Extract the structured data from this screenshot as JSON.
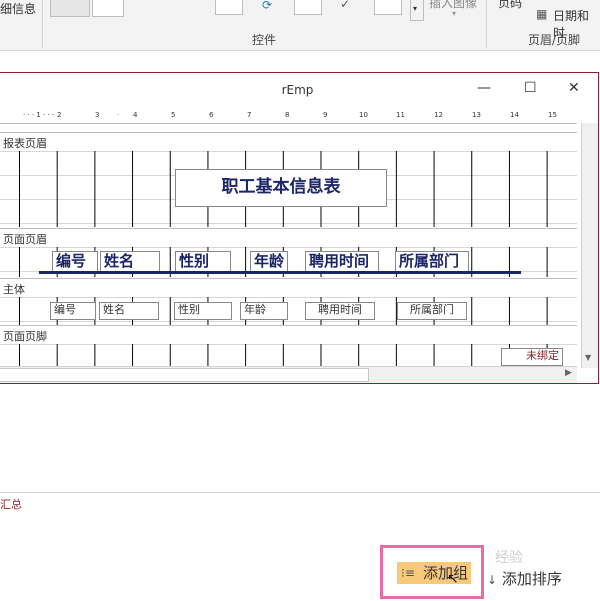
{
  "ribbon": {
    "left_cut_text": "细信息",
    "insert_image_label": "插入图像",
    "controls_group_label": "控件",
    "page_number_label": "页码",
    "date_time_label": "日期和时",
    "header_footer_group_label": "页眉/页脚"
  },
  "window": {
    "title": "rEmp",
    "minimize_glyph": "—",
    "maximize_glyph": "☐",
    "close_glyph": "✕",
    "ruler_numbers": [
      "1",
      "2",
      "3",
      "4",
      "5",
      "6",
      "7",
      "8",
      "9",
      "10",
      "11",
      "12",
      "13",
      "14",
      "15"
    ]
  },
  "sections": {
    "report_header": "报表页眉",
    "page_header": "页面页眉",
    "detail": "主体",
    "page_footer": "页面页脚"
  },
  "report_title": "职工基本信息表",
  "header_labels": [
    "编号",
    "姓名",
    "性别",
    "年龄",
    "聘用时间",
    "所属部门"
  ],
  "detail_fields": [
    "编号",
    "姓名",
    "性别",
    "年龄",
    "聘用时间",
    "所属部门"
  ],
  "unbound_text": "未绑定",
  "bottom": {
    "summary_label": "汇总",
    "add_group_label": "添加组",
    "add_sort_label": "添加排序",
    "watermark": "经验"
  },
  "colors": {
    "window_border": "#8c1f2a",
    "title_text": "#1c2566",
    "highlight_box": "#e86aa6",
    "button_fill": "#f8c97a",
    "unbound_text": "#8c1f2a"
  }
}
